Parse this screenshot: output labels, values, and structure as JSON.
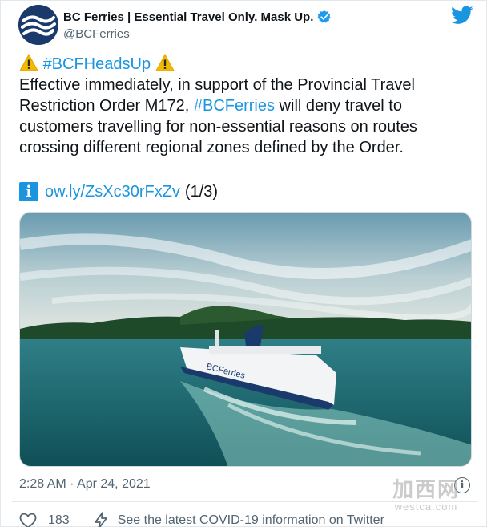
{
  "author": {
    "display_name": "BC Ferries | Essential Travel Only. Mask Up.",
    "handle": "@BCFerries",
    "verified": true,
    "avatar_icon": "bc-ferries-wave-logo-icon",
    "brand_color": "#1a3a6b"
  },
  "platform": {
    "logo_icon": "twitter-bird-icon",
    "accent_color": "#1b95e0"
  },
  "tweet": {
    "warning_icon": "warning-sign-icon",
    "hashtag_heading": "#BCFHeadsUp",
    "line2": "Effective immediately, in support of the Provincial Travel",
    "line3_before": "Restriction Order M172, ",
    "line3_hashtag": "#BCFerries",
    "line3_after": " will deny travel to",
    "line4": "customers travelling for non-essential reasons on routes",
    "line5": "crossing different regional zones defined by the Order.",
    "info_icon": "information-icon",
    "info_icon_glyph": "i",
    "short_link": "ow.ly/ZsXc30rFxZv",
    "thread_count": "(1/3)"
  },
  "media": {
    "description_icon": "ferry-photo"
  },
  "meta": {
    "timestamp": "2:28 AM · Apr 24, 2021",
    "info_glyph": "i"
  },
  "watermark": {
    "cn": "加西网",
    "en": "westca.com"
  },
  "actions": {
    "like_icon": "heart-icon",
    "like_count": "183",
    "covid_icon": "lightning-bolt-icon",
    "covid_text": "See the latest COVID-19 information on Twitter"
  }
}
